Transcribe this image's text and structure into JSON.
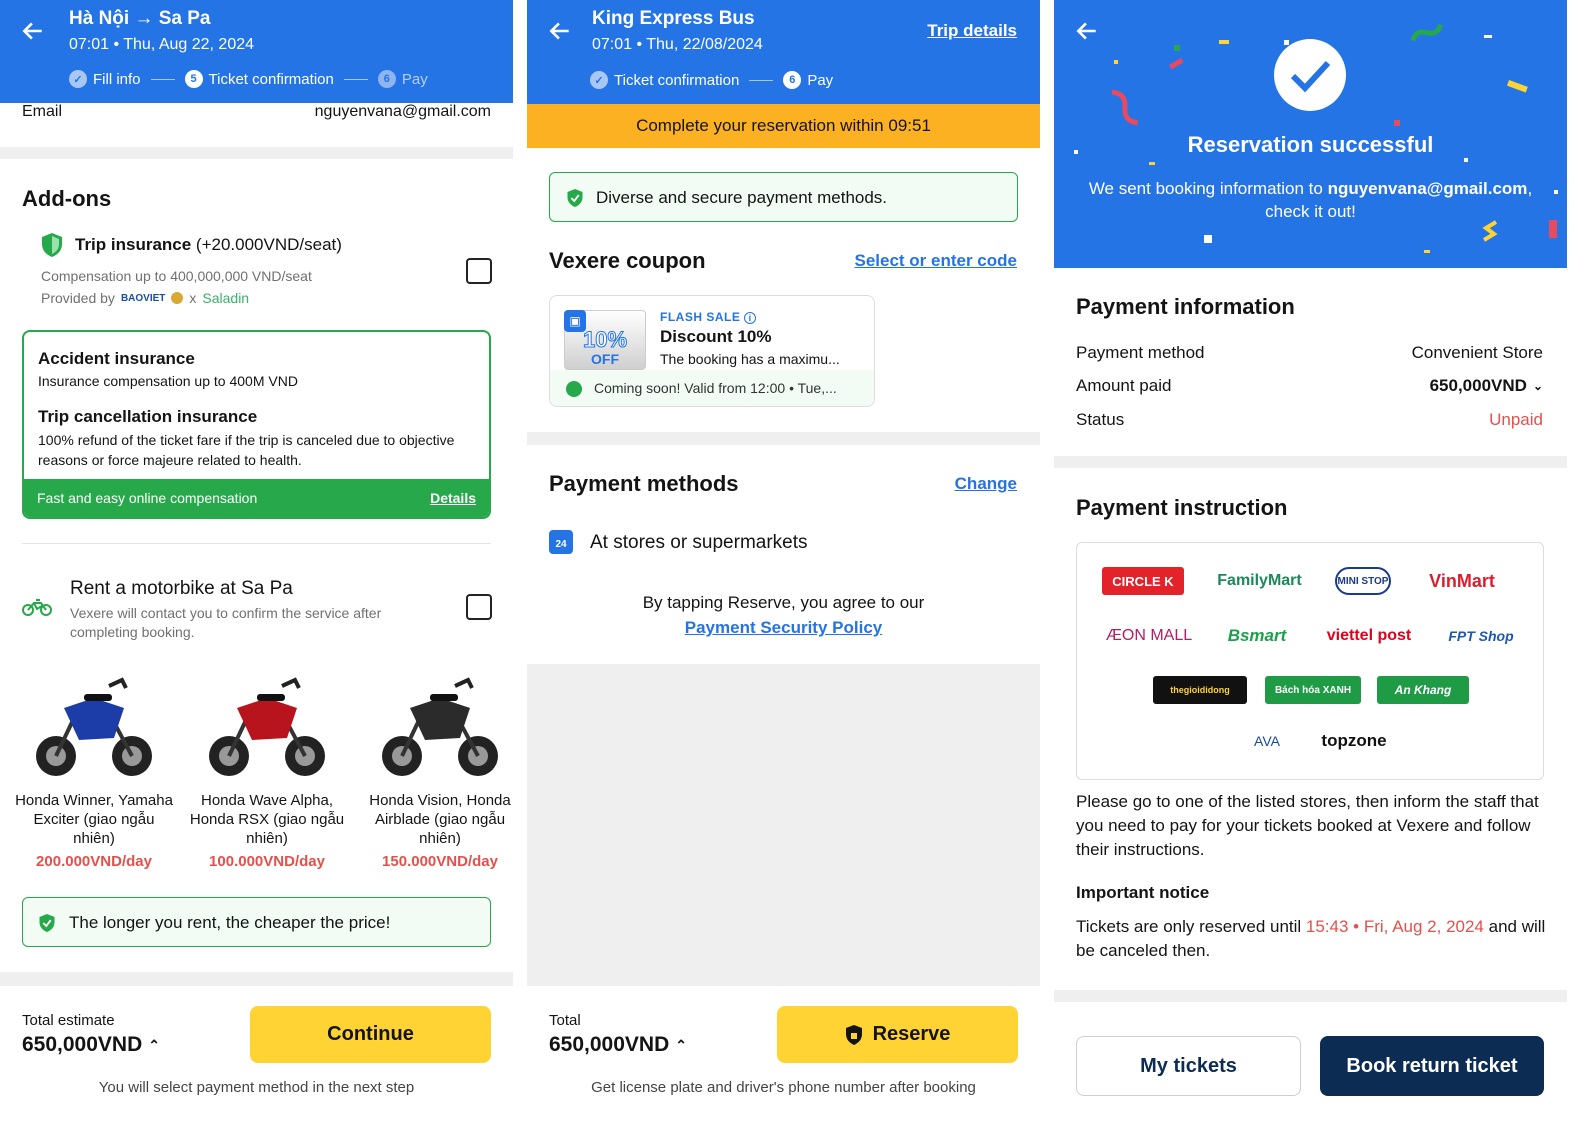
{
  "panel1": {
    "title": "Hà Nội → Sa Pa",
    "datetime": "07:01 • Thu, Aug 22, 2024",
    "steps": [
      {
        "label": "Fill info",
        "marker": "✓"
      },
      {
        "label": "Ticket confirmation",
        "marker": "5"
      },
      {
        "label": "Pay",
        "marker": "6"
      }
    ],
    "email_label": "Email",
    "email_value": "nguyenvana@gmail.com",
    "addons_title": "Add-ons",
    "trip_ins_title": "Trip insurance",
    "trip_ins_price": " (+20.000VND/seat)",
    "trip_ins_desc": "Compensation up to 400,000,000 VND/seat",
    "provided_by": "Provided by",
    "baoviet": "BAOVIET",
    "x": "x",
    "saladin": "Saladin",
    "acc_title": "Accident insurance",
    "acc_desc": "Insurance compensation up to 400M VND",
    "cancel_title": "Trip cancellation insurance",
    "cancel_desc": "100% refund of the ticket fare if the trip is canceled due to objective reasons or force majeure related to health.",
    "green_bar": "Fast and easy online compensation",
    "details": "Details",
    "moto_title": "Rent a motorbike at Sa Pa",
    "moto_desc": "Vexere will contact you to confirm the service after completing booking.",
    "bikes": [
      {
        "name": "Honda Winner, Yamaha Exciter (giao ngẫu nhiên)",
        "price": "200.000VND/day",
        "color": "#1c3da8"
      },
      {
        "name": "Honda Wave Alpha, Honda RSX (giao ngẫu nhiên)",
        "price": "100.000VND/day",
        "color": "#b8141d"
      },
      {
        "name": "Honda Vision, Honda Airblade (giao ngẫu nhiên)",
        "price": "150.000VND/day",
        "color": "#2b2b2b"
      }
    ],
    "rent_note": "The longer you rent, the cheaper the price!",
    "total_label": "Total estimate",
    "total_value": "650,000VND",
    "continue": "Continue",
    "footer_note": "You will select payment method in the next step"
  },
  "panel2": {
    "title": "King Express Bus",
    "datetime": "07:01 • Thu, 22/08/2024",
    "trip_details": "Trip details",
    "steps": [
      {
        "label": "Ticket confirmation",
        "marker": "✓"
      },
      {
        "label": "Pay",
        "marker": "6"
      }
    ],
    "timer_text": "Complete your reservation within ",
    "timer": "09:51",
    "secure": "Diverse and secure payment methods.",
    "coupon_title": "Vexere coupon",
    "coupon_link": "Select or enter code",
    "coupon_badge": "10%",
    "coupon_off": "OFF",
    "flash": "FLASH SALE",
    "coupon_name": "Discount 10%",
    "coupon_desc": "The booking has a maximu...",
    "coupon_valid": "Coming soon! Valid from 12:00 • Tue,...",
    "pm_title": "Payment methods",
    "pm_change": "Change",
    "pm_item": "At stores or supermarkets",
    "agree": "By tapping Reserve, you agree to our",
    "policy": "Payment Security Policy",
    "total_label": "Total",
    "total_value": "650,000VND",
    "reserve": "Reserve",
    "footer_note": "Get license plate and driver's phone number after booking"
  },
  "panel3": {
    "success": "Reservation successful",
    "sent_pre": "We sent booking information to ",
    "sent_email": "nguyenvana@gmail.com",
    "sent_post": ", check it out!",
    "pi_title": "Payment information",
    "rows": [
      {
        "label": "Payment method",
        "value": "Convenient Store"
      },
      {
        "label": "Amount paid",
        "value": "650,000VND"
      },
      {
        "label": "Status",
        "value": "Unpaid"
      }
    ],
    "instr_title": "Payment instruction",
    "stores": [
      "CIRCLE K",
      "FamilyMart",
      "MINI STOP",
      "VinMart",
      "ÆON MALL",
      "Bsmart",
      "viettel post",
      "FPT Shop",
      "thegioididong",
      "Bách hóa XANH",
      "An Khang",
      "AVA",
      "topzone"
    ],
    "instr_text": "Please go to one of the listed stores, then inform the staff that you need to pay for your tickets booked at Vexere and follow their instructions.",
    "notice_title": "Important notice",
    "notice_pre": "Tickets are only reserved until ",
    "notice_time": "15:43 • Fri, Aug 2, 2024",
    "notice_post": " and will be canceled then.",
    "my_tickets": "My tickets",
    "book_return": "Book return ticket"
  },
  "colors": {
    "primary": "#2474e5",
    "yellow": "#ffd333",
    "green": "#27a84a",
    "red": "#e4504c",
    "navy": "#0d2c54",
    "orange": "#fcb122"
  }
}
